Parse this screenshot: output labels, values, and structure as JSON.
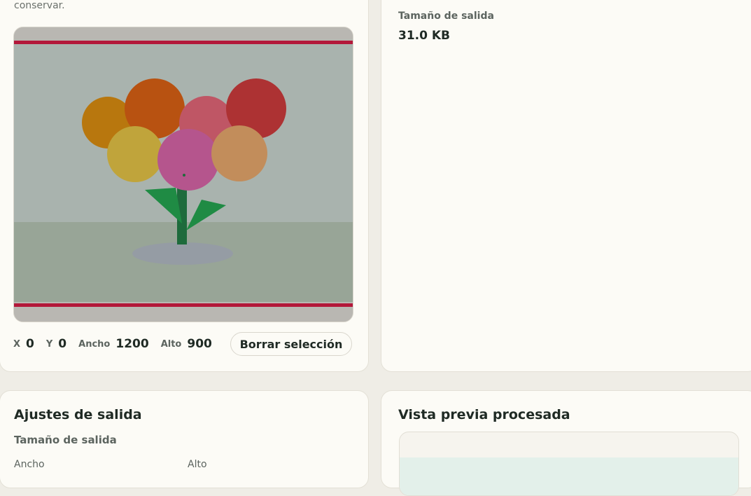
{
  "crop_card": {
    "cut_text": "conservar.",
    "coords": {
      "x_label": "X",
      "x_value": "0",
      "y_label": "Y",
      "y_value": "0",
      "width_label": "Ancho",
      "width_value": "1200",
      "height_label": "Alto",
      "height_value": "900"
    },
    "clear_button_label": "Borrar selección"
  },
  "info_card": {
    "output_size_label": "Tamaño de salida",
    "output_size_value": "31.0 KB"
  },
  "settings_card": {
    "title": "Ajustes de salida",
    "output_size_label": "Tamaño de salida",
    "width_label": "Ancho",
    "height_label": "Alto"
  },
  "preview_card": {
    "title": "Vista previa procesada"
  },
  "colors": {
    "page_background": "#efede6",
    "card_background": "#fcfbf6",
    "selection_border": "#b3183a",
    "sky": "#a9b3ae",
    "ground": "#98a597",
    "stem": "#1e6b3c"
  }
}
